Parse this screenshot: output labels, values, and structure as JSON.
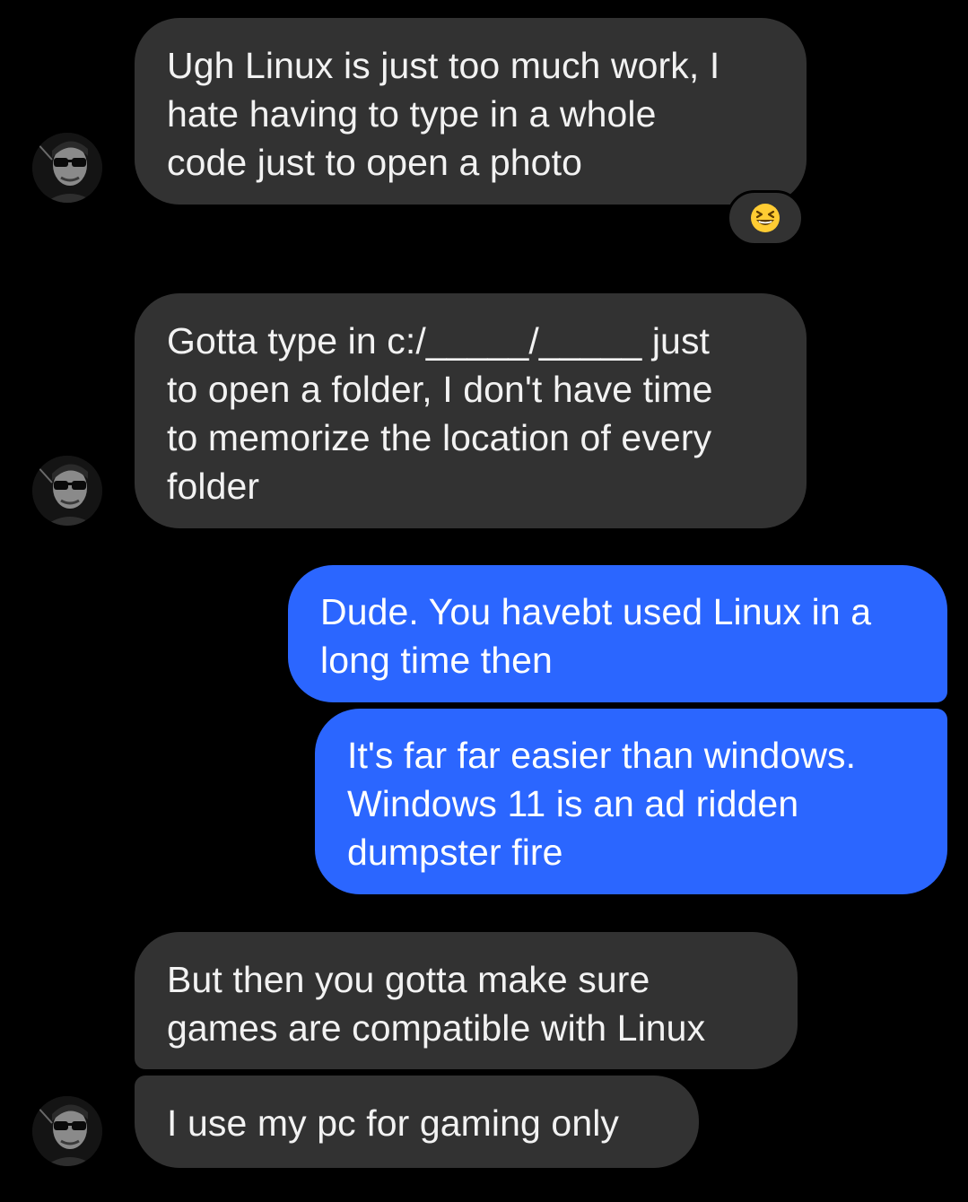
{
  "conversation": {
    "messages": [
      {
        "id": "m1",
        "sender": "contact",
        "text": "Ugh Linux is just too much work, I\nhate having to type in a whole\ncode just to open a photo",
        "reaction": "grinning-squinting-face"
      },
      {
        "id": "m2",
        "sender": "contact",
        "text": "Gotta type in c:/_____/_____ just\nto open a folder, I don't have time\nto memorize the location of every\nfolder"
      },
      {
        "id": "m3",
        "sender": "me",
        "text": "Dude. You havebt used Linux in a\nlong time then"
      },
      {
        "id": "m4",
        "sender": "me",
        "text": "It's far far easier than windows.\nWindows 11 is an ad ridden\ndumpster fire"
      },
      {
        "id": "m5",
        "sender": "contact",
        "text": "But then you gotta make sure\ngames are compatible with Linux"
      },
      {
        "id": "m6",
        "sender": "contact",
        "text": "I use my pc for gaming only"
      }
    ]
  },
  "colors": {
    "background": "#000000",
    "incoming_bubble": "#323232",
    "outgoing_bubble": "#2b66ff",
    "text": "#ffffff"
  },
  "icons": {
    "avatar": "contact-avatar-sunglasses",
    "reaction": "grinning-squinting-face-emoji"
  }
}
